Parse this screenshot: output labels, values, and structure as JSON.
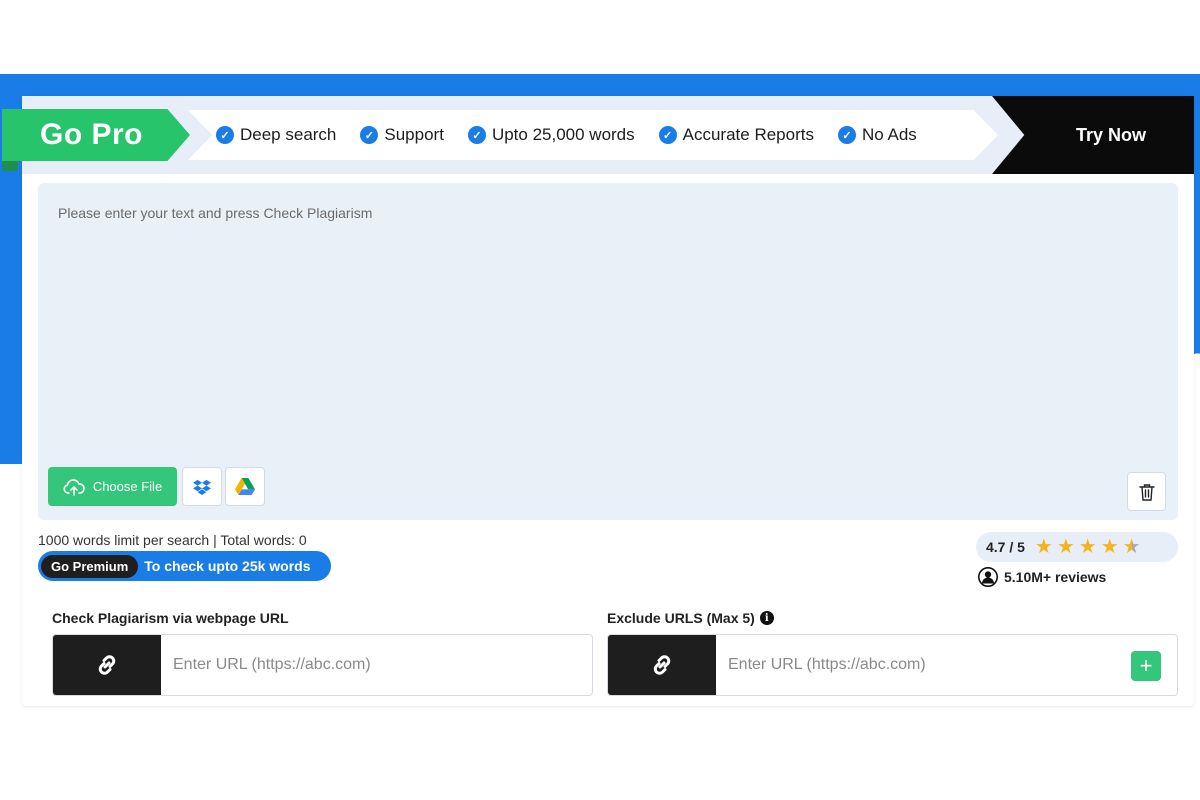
{
  "promo": {
    "go_pro_label": "Go Pro",
    "features": [
      "Deep search",
      "Support",
      "Upto 25,000 words",
      "Accurate Reports",
      "No Ads"
    ],
    "try_now_label": "Try Now"
  },
  "editor": {
    "placeholder": "Please enter your text and press Check Plagiarism",
    "choose_file_label": "Choose File"
  },
  "stats": {
    "limit_text": "1000 words limit per search | Total words: 0",
    "premium_tag": "Go Premium",
    "premium_text": "To check upto 25k words"
  },
  "rating": {
    "value_text": "4.7 / 5",
    "value": 4.7,
    "max": 5,
    "reviews_text": "5.10M+ reviews"
  },
  "url_check": {
    "label": "Check Plagiarism via webpage URL",
    "placeholder": "Enter URL (https://abc.com)"
  },
  "exclude_urls": {
    "label": "Exclude URLS (Max 5)",
    "placeholder": "Enter URL (https://abc.com)"
  },
  "colors": {
    "brand_blue": "#1a7ce6",
    "brand_green": "#27c46b",
    "dark": "#0b0b0b"
  }
}
